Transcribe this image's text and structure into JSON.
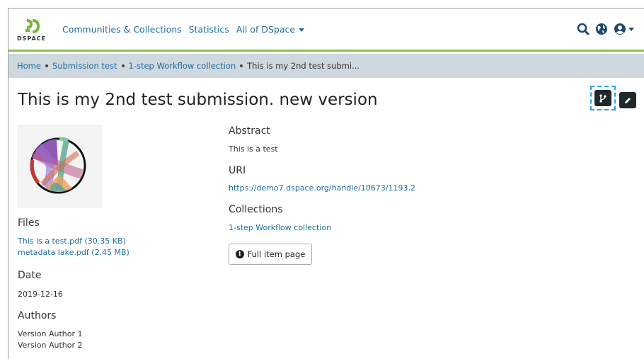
{
  "header": {
    "logo_text": "DSPACE",
    "nav": {
      "communities": "Communities & Collections",
      "statistics": "Statistics",
      "all": "All of DSpace"
    }
  },
  "breadcrumb": {
    "home": "Home",
    "submission": "Submission test",
    "collection": "1-step Workflow collection",
    "current": "This is my 2nd test submi..."
  },
  "item": {
    "title": "This is my 2nd test submission. new version",
    "files_label": "Files",
    "files": [
      "This is a test.pdf (30.35 KB)",
      "metadata lake.pdf (2.45 MB)"
    ],
    "date_label": "Date",
    "date": "2019-12-16",
    "authors_label": "Authors",
    "authors": [
      "Version Author 1",
      "Version Author 2"
    ],
    "abstract_label": "Abstract",
    "abstract": "This is a test",
    "uri_label": "URI",
    "uri": "https://demo7.dspace.org/handle/10673/1193.2",
    "collections_label": "Collections",
    "collection": "1-step Workflow collection",
    "full_item_label": "Full item page"
  },
  "colors": {
    "accent_green": "#8bc34a",
    "link": "#1f6d9e",
    "breadcrumb_bg": "#cfd8de",
    "dark_button": "#1e272c",
    "focus_dash": "#29a3e0"
  },
  "icons": {
    "search": "search-icon",
    "globe": "globe-icon",
    "user": "user-icon",
    "version": "code-branch-icon",
    "edit": "pencil-icon",
    "info": "info-circle-icon"
  }
}
